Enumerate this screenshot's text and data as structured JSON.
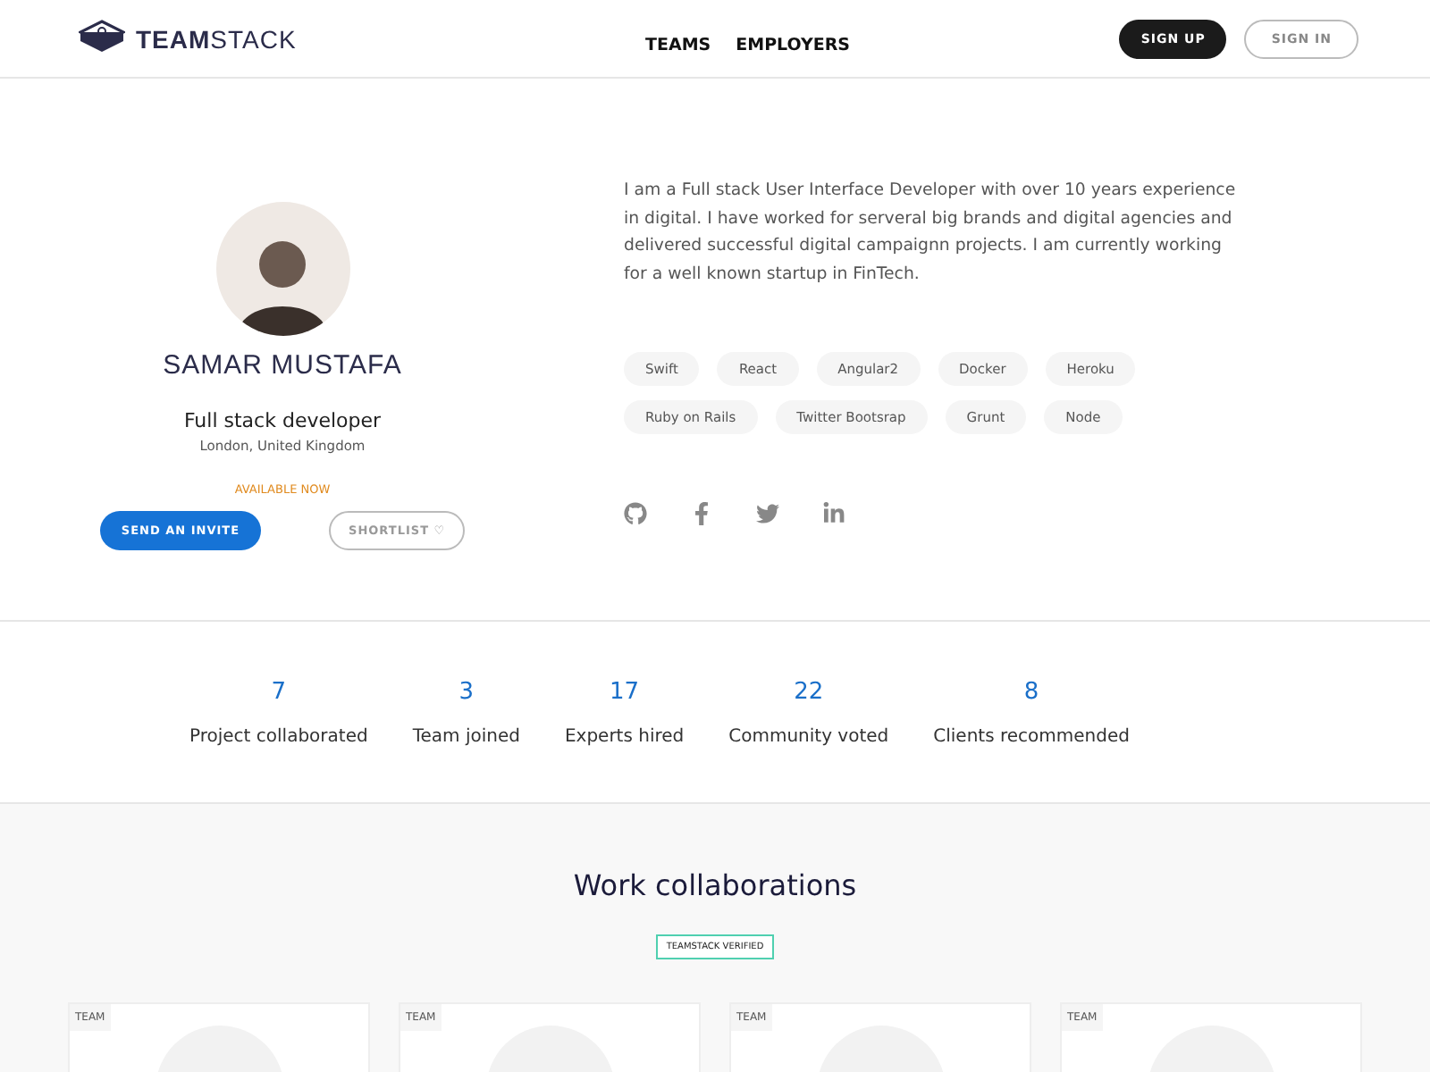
{
  "header": {
    "logo": "**TEAM**STACK",
    "nav": [
      "TEAMS",
      "EMPLOYERS"
    ],
    "sign_up": "SIGN UP",
    "sign_in": "SIGN IN"
  },
  "profile": {
    "name": "SAMAR MUSTAFA",
    "role": "Full stack developer",
    "location": "London, United Kingdom",
    "availability": "AVAILABLE NOW",
    "invite_button": "SEND AN INVITE",
    "shortlist_button": "SHORTLIST ♡",
    "bio": "I am a Full stack User Interface Developer with over 10 years experience in digital. I have worked for serveral big brands and digital agencies and delivered successful digital campaignn projects. I am currently working for a well known startup in FinTech.",
    "skills": [
      "Swift",
      "React",
      "Angular2",
      "Docker",
      "Heroku",
      "Ruby on Rails",
      "Twitter Bootsrap",
      "Grunt",
      "Node"
    ],
    "social": [
      {
        "kind": "github"
      },
      {
        "kind": "facebook"
      },
      {
        "kind": "twitter"
      },
      {
        "kind": "linkedin"
      }
    ]
  },
  "stats": [
    {
      "value": "7",
      "label": "Project collaborated"
    },
    {
      "value": "3",
      "label": "Team joined"
    },
    {
      "value": "17",
      "label": "Experts hired"
    },
    {
      "value": "22",
      "label": "Community voted"
    },
    {
      "value": "8",
      "label": "Clients recommended"
    }
  ],
  "collaborations": {
    "title": "Work collaborations",
    "badge": "TEAMSTACK VERIFIED",
    "cards": [
      {
        "tag": "TEAM"
      },
      {
        "tag": "TEAM"
      },
      {
        "tag": "TEAM"
      },
      {
        "tag": "TEAM"
      }
    ]
  }
}
